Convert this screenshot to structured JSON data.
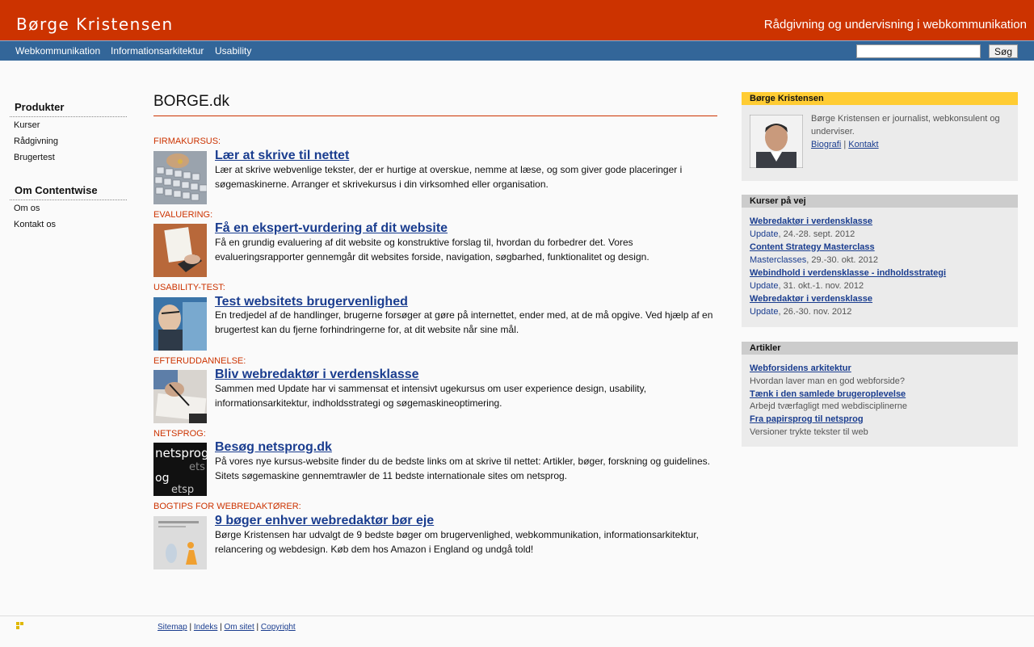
{
  "header": {
    "logo": "Børge Kristensen",
    "tagline": "Rådgivning og undervisning i webkommunikation"
  },
  "nav": {
    "items": [
      "Webkommunikation",
      "Informationsarkitektur",
      "Usability"
    ],
    "search_value": "",
    "search_button": "Søg"
  },
  "sidebar": {
    "sections": [
      {
        "heading": "Produkter",
        "items": [
          "Kurser",
          "Rådgivning",
          "Brugertest"
        ]
      },
      {
        "heading": "Om Contentwise",
        "items": [
          "Om os",
          "Kontakt os"
        ]
      }
    ]
  },
  "main": {
    "title": "BORGE.dk",
    "entries": [
      {
        "category": "Firmakursus:",
        "title": "Lær at skrive til nettet",
        "desc": "Lær at skrive webvenlige tekster, der er hurtige at overskue, nemme at læse, og som giver gode placeringer i søgemaskinerne. Arranger et skrivekursus i din virksomhed eller organisation."
      },
      {
        "category": "Evaluering:",
        "title": "Få en ekspert-vurdering af dit website",
        "desc": "Få en grundig evaluering af dit website og konstruktive forslag til, hvordan du forbedrer det. Vores evalueringsrapporter gennemgår dit websites forside, navigation, søgbarhed, funktionalitet og design."
      },
      {
        "category": "Usability-test:",
        "title": "Test websitets brugervenlighed",
        "desc": "En tredjedel af de handlinger, brugerne forsøger at gøre på internettet, ender med, at de må opgive. Ved hjælp af en brugertest kan du fjerne forhindringerne for, at dit website når sine mål."
      },
      {
        "category": "Efteruddannelse:",
        "title": "Bliv webredaktør i verdensklasse",
        "desc": "Sammen med Update har vi sammensat et intensivt ugekursus om user experience design, usability, informationsarkitektur, indholdsstrategi og søgemaskineoptimering."
      },
      {
        "category": "Netsprog:",
        "title": "Besøg netsprog.dk",
        "desc": "På vores nye kursus-website finder du de bedste links om at skrive til nettet: Artikler, bøger, forskning og guidelines. Sitets søgemaskine gennemtrawler de 11 bedste internationale sites om netsprog."
      },
      {
        "category": "Bogtips for webredaktører:",
        "title": "9 bøger enhver webredaktør bør eje",
        "desc": "Børge Kristensen har udvalgt de 9 bedste bøger om brugervenlighed, webkommunikation, informationsarkitektur, relancering og webdesign. Køb dem hos Amazon i England og undgå told!"
      }
    ],
    "thumb_text": {
      "netsprog": "netsprog"
    }
  },
  "right": {
    "profile": {
      "heading": "Børge Kristensen",
      "text_1": "Børge Kristensen er journalist, webkonsulent og",
      "text_2": "underviser.",
      "link_bio": "Biografi",
      "sep": "|",
      "link_contact": "Kontakt"
    },
    "courses": {
      "heading": "Kurser på vej",
      "items": [
        {
          "title": "Webredaktør i verdensklasse",
          "org": "Update",
          "date": ", 24.-28. sept. 2012"
        },
        {
          "title": "Content Strategy Masterclass",
          "org": "Masterclasses",
          "date": ", 29.-30. okt. 2012"
        },
        {
          "title": "Webindhold i verdensklasse - indholdsstrategi",
          "org": "Update",
          "date": ", 31. okt.-1. nov. 2012"
        },
        {
          "title": "Webredaktør i verdensklasse",
          "org": "Update",
          "date": ", 26.-30. nov. 2012"
        }
      ]
    },
    "articles": {
      "heading": "Artikler",
      "items": [
        {
          "title": "Webforsidens arkitektur",
          "sub": "Hvordan laver man en god webforside?"
        },
        {
          "title": "Tænk i den samlede brugeroplevelse",
          "sub": "Arbejd tværfagligt med webdisciplinerne"
        },
        {
          "title": "Fra papirsprog til netsprog",
          "sub": "Versioner trykte tekster til web"
        }
      ]
    }
  },
  "footer": {
    "links": [
      "Sitemap",
      "Indeks",
      "Om sitet",
      "Copyright"
    ],
    "sep": "|"
  },
  "colors": {
    "header": "#cc3300",
    "nav": "#336699",
    "profile_head": "#ffcc33",
    "box_head": "#cccccc",
    "link": "#1a3d8f"
  }
}
